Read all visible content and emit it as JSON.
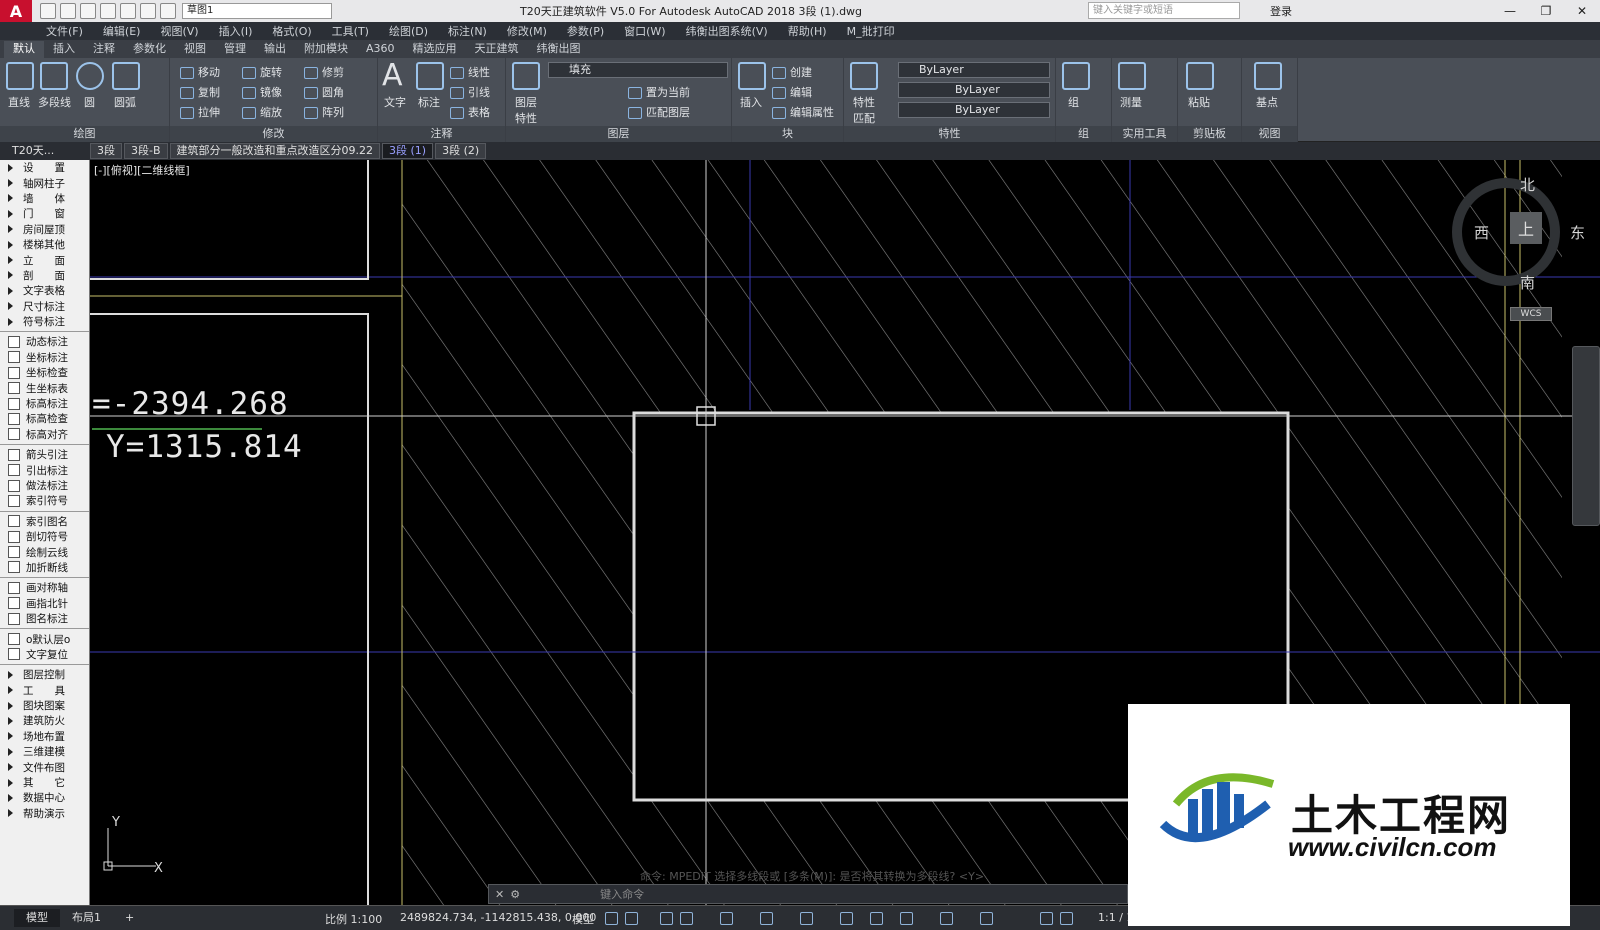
{
  "titlebar": {
    "workspace": "草图1",
    "title": "T20天正建筑软件 V5.0 For Autodesk AutoCAD 2018    3段 (1).dwg",
    "search_placeholder": "键入关键字或短语",
    "login": "登录"
  },
  "menu": [
    "文件(F)",
    "编辑(E)",
    "视图(V)",
    "插入(I)",
    "格式(O)",
    "工具(T)",
    "绘图(D)",
    "标注(N)",
    "修改(M)",
    "参数(P)",
    "窗口(W)",
    "纬衡出图系统(V)",
    "帮助(H)",
    "M_批打印"
  ],
  "ribbon_tabs": [
    "默认",
    "插入",
    "注释",
    "参数化",
    "视图",
    "管理",
    "输出",
    "附加模块",
    "A360",
    "精选应用",
    "天正建筑",
    "纬衡出图"
  ],
  "ribbon": {
    "draw": {
      "title": "绘图",
      "line": "直线",
      "polyline": "多段线",
      "circle": "圆",
      "arc": "圆弧"
    },
    "modify": {
      "title": "修改",
      "move": "移动",
      "rotate": "旋转",
      "trim": "修剪",
      "copy": "复制",
      "mirror": "镜像",
      "fillet": "圆角",
      "stretch": "拉伸",
      "scale": "缩放",
      "array": "阵列"
    },
    "annotation": {
      "title": "注释",
      "text": "文字",
      "dim": "标注",
      "linear": "线性",
      "leader": "引线",
      "table": "表格"
    },
    "layers": {
      "title": "图层",
      "props": "图层特性",
      "layer_name": "填充",
      "set_current": "置为当前",
      "match": "匹配图层"
    },
    "block": {
      "title": "块",
      "insert": "插入",
      "create": "创建",
      "edit": "编辑",
      "edit_attr": "编辑属性"
    },
    "properties": {
      "title": "特性",
      "match": "特性匹配",
      "color": "ByLayer",
      "linetype": "ByLayer",
      "lineweight": "ByLayer"
    },
    "groups": {
      "title": "组",
      "group": "组"
    },
    "utilities": {
      "title": "实用工具",
      "measure": "测量"
    },
    "clipboard": {
      "title": "剪贴板",
      "paste": "粘贴"
    },
    "view": {
      "title": "视图",
      "base": "基点"
    }
  },
  "palette_header": "T20天...",
  "palette_sections": [
    [
      "设　　置",
      "轴网柱子",
      "墙　　体",
      "门　　窗",
      "房间屋顶",
      "楼梯其他",
      "立　　面",
      "剖　　面",
      "文字表格",
      "尺寸标注",
      "符号标注"
    ],
    [
      "动态标注",
      "坐标标注",
      "坐标检查",
      "生坐标表",
      "标高标注",
      "标高检查",
      "标高对齐"
    ],
    [
      "箭头引注",
      "引出标注",
      "做法标注",
      "索引符号"
    ],
    [
      "索引图名",
      "剖切符号",
      "绘制云线",
      "加折断线"
    ],
    [
      "画对称轴",
      "画指北针",
      "图名标注"
    ],
    [
      "o默认层o",
      "文字复位"
    ],
    [
      "图层控制",
      "工　　具",
      "图块图案",
      "建筑防火",
      "场地布置",
      "三维建模",
      "文件布图",
      "其　　它",
      "数据中心",
      "帮助演示"
    ]
  ],
  "file_tabs": [
    "3段",
    "3段-B",
    "建筑部分一般改造和重点改造区分09.22",
    "3段 (1)",
    "3段 (2)"
  ],
  "active_file_tab": 3,
  "viewport_label": "[-][俯视][二维线框]",
  "viewcube": {
    "north": "北",
    "south": "南",
    "east": "东",
    "west": "西",
    "top": "上",
    "wcs": "WCS"
  },
  "coord_display": {
    "x": "=-2394.268",
    "y": "Y=1315.814"
  },
  "ucs": {
    "x": "X",
    "y": "Y"
  },
  "command": {
    "placeholder": "键入命令",
    "history": "命令: MPEDIT   选择多线段或 [多条(M)]: 是否将其转换为多段线? <Y>"
  },
  "status": {
    "tabs": [
      "模型",
      "布局1"
    ],
    "scale": "比例 1:100",
    "coords": "2489824.734, -1142815.438, 0.000",
    "model": "模型",
    "anno_scale": "1:1 / 100%"
  },
  "watermark": {
    "name": "土木工程网",
    "url": "www.civilcn.com"
  },
  "colors": {
    "canvas": "#000000",
    "hatch": "#7a7a7a",
    "grid": "#3a3aa0",
    "wall": "#d8d8d8",
    "accent": "#c8102e"
  }
}
